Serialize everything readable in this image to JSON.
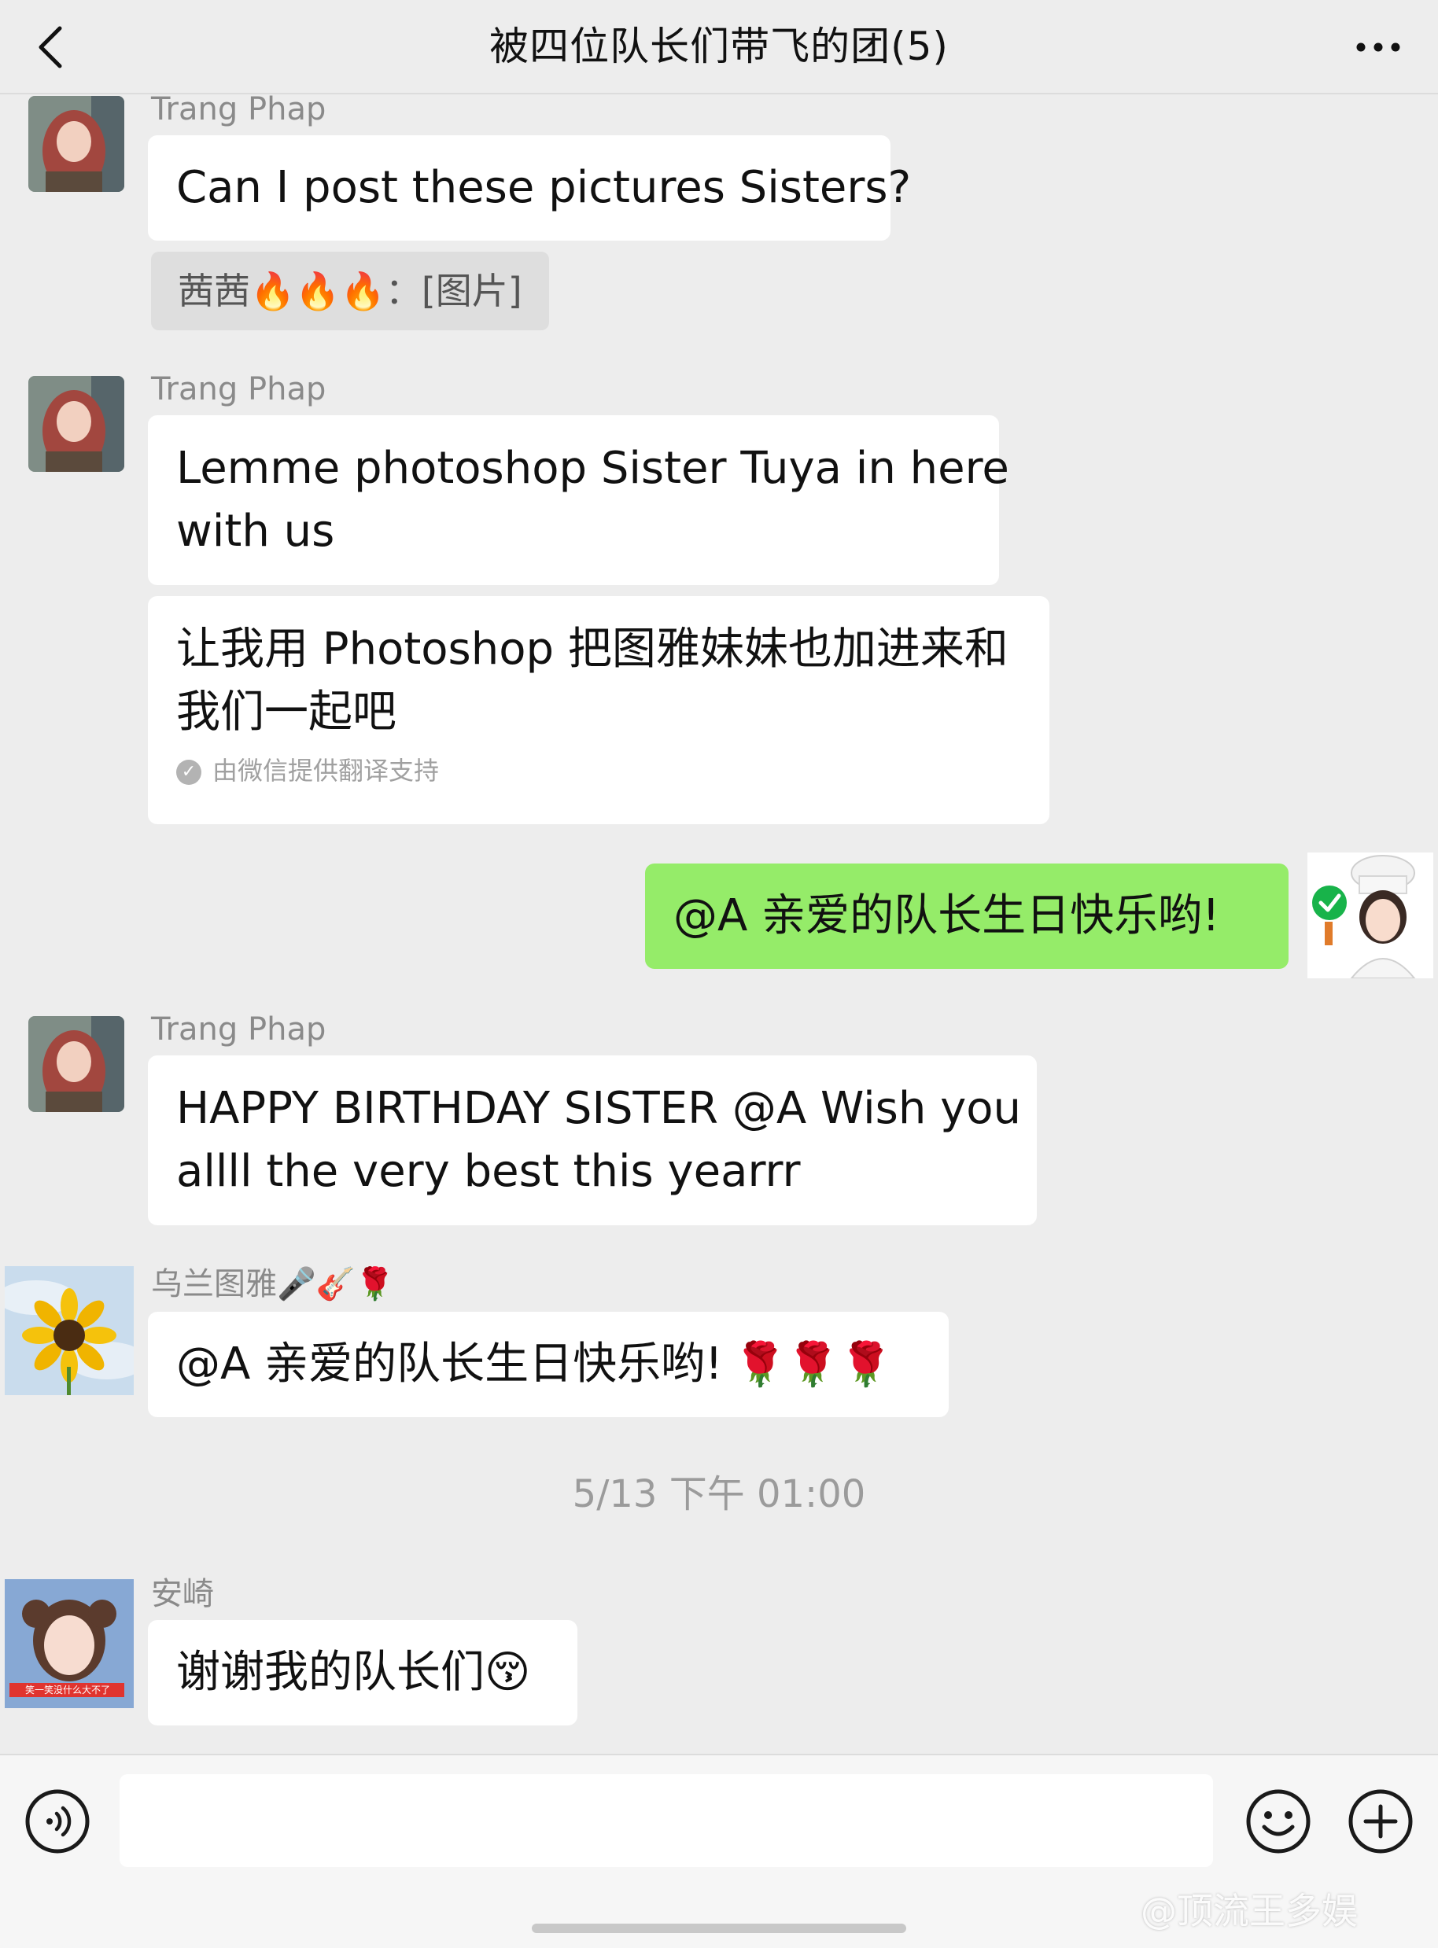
{
  "header": {
    "title": "被四位队长们带飞的团(5)",
    "back_icon": "chevron-left-icon",
    "more_icon": "more-horizontal-icon"
  },
  "messages": {
    "m1": {
      "sender": "Trang Phap",
      "text": "Can I post these pictures Sisters?",
      "quote_name": "茜茜",
      "quote_flames": "🔥🔥🔥",
      "quote_text": "：[图片]"
    },
    "m2": {
      "sender": "Trang Phap",
      "text_line1": "Lemme photoshop Sister Tuya in here",
      "text_line2": "with us",
      "translation_line1": "让我用 Photoshop 把图雅妹妹也加进来和",
      "translation_line2": "我们一起吧",
      "translation_note": "由微信提供翻译支持"
    },
    "m3": {
      "text": "@A 亲爱的队长生日快乐哟!"
    },
    "m4": {
      "sender": "Trang Phap",
      "text_line1": "HAPPY BIRTHDAY SISTER @A Wish you",
      "text_line2": "allll the very best this yearrr"
    },
    "m5": {
      "sender": "乌兰图雅🎤🎸🌹",
      "text": "@A 亲爱的队长生日快乐哟!",
      "roses": "🌹🌹🌹"
    },
    "timestamp": "5/13 下午 01:00",
    "m6": {
      "sender": "安崎",
      "text": "谢谢我的队长们",
      "emoji": "😚",
      "avatar_caption": "笑一笑没什么大不了"
    }
  },
  "input_bar": {
    "placeholder": "",
    "voice_icon": "voice-icon",
    "emoji_icon": "emoji-icon",
    "plus_icon": "plus-circle-icon"
  },
  "watermark": "@顶流王多娱"
}
